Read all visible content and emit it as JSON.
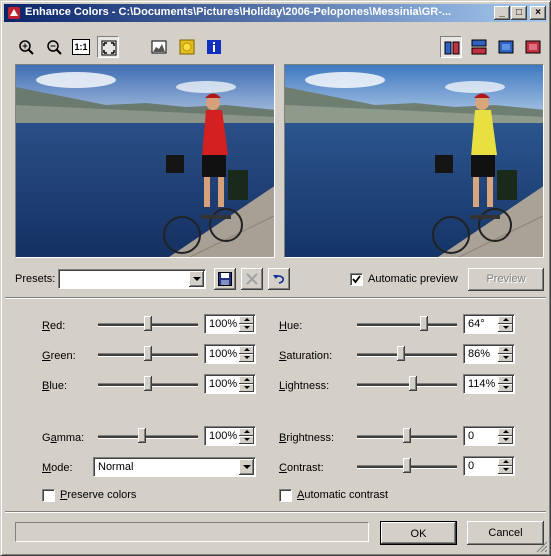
{
  "window": {
    "title": "Enhance Colors - C:\\Documents\\Pictures\\Holiday\\2006-Pelopones\\Messinia\\GR-..."
  },
  "toolbar": {
    "left": [
      "zoom-in-icon",
      "zoom-out-icon",
      "actual-size-icon",
      "fit-window-icon",
      "histogram-icon",
      "color-icon",
      "info-icon"
    ],
    "right": [
      "split-vertical-icon",
      "split-horizontal-icon",
      "original-only-icon",
      "result-only-icon"
    ],
    "one_to_one": "1:1"
  },
  "presets": {
    "label": "Presets:",
    "value": ""
  },
  "automatic_preview": {
    "label": "Automatic preview",
    "checked": true
  },
  "preview_button": "Preview",
  "left_controls": [
    {
      "label_u": "R",
      "label_rest": "ed:",
      "value": "100%",
      "level": 0.5
    },
    {
      "label_u": "G",
      "label_rest": "reen:",
      "value": "100%",
      "level": 0.5
    },
    {
      "label_u": "B",
      "label_rest": "lue:",
      "value": "100%",
      "level": 0.5
    }
  ],
  "right_controls": [
    {
      "label_u": "H",
      "label_rest": "ue:",
      "value": "64°",
      "level": 0.68
    },
    {
      "label_u": "S",
      "label_rest": "aturation:",
      "value": "86%",
      "level": 0.43
    },
    {
      "label_u": "L",
      "label_rest": "ightness:",
      "value": "114%",
      "level": 0.57
    }
  ],
  "gamma": {
    "label_u": "a",
    "label_pre": "G",
    "label_rest": "mma:",
    "value": "100%",
    "level": 0.43
  },
  "brightness": {
    "label_u": "B",
    "label_rest": "rightness:",
    "value": "0",
    "level": 0.5
  },
  "contrast": {
    "label_u": "C",
    "label_rest": "ontrast:",
    "value": "0",
    "level": 0.5
  },
  "mode": {
    "label_u": "M",
    "label_rest": "ode:",
    "value": "Normal"
  },
  "preserve_colors": {
    "label_u": "P",
    "label_rest": "reserve colors",
    "checked": false
  },
  "automatic_contrast": {
    "label_u": "A",
    "label_rest": "utomatic contrast",
    "checked": false
  },
  "ok": "OK",
  "cancel": "Cancel",
  "colors": {
    "title_start": "#0a246a",
    "title_end": "#a6caf0",
    "shirt_left": "#d42020",
    "shirt_right": "#e8e040"
  }
}
